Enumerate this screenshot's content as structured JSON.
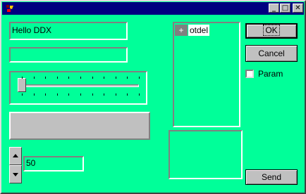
{
  "window": {
    "title": "",
    "minimize_glyph": "_",
    "maximize_glyph": "□",
    "close_glyph": "✕"
  },
  "form": {
    "text_edit_value": "Hello DDX",
    "second_edit_value": "",
    "slider_value_fraction": 0.0,
    "progress_fraction": 0.0,
    "spin_value": "50"
  },
  "tree": {
    "items": [
      {
        "expander": "+",
        "label": "otdel"
      }
    ]
  },
  "buttons": {
    "ok_label": "OK",
    "cancel_label": "Cancel",
    "send_label": "Send"
  },
  "checkbox": {
    "label": "Param",
    "checked": false
  },
  "colors": {
    "client_background": "#00ff99",
    "titlebar": "#000080",
    "button_face": "#c0c0c0"
  }
}
